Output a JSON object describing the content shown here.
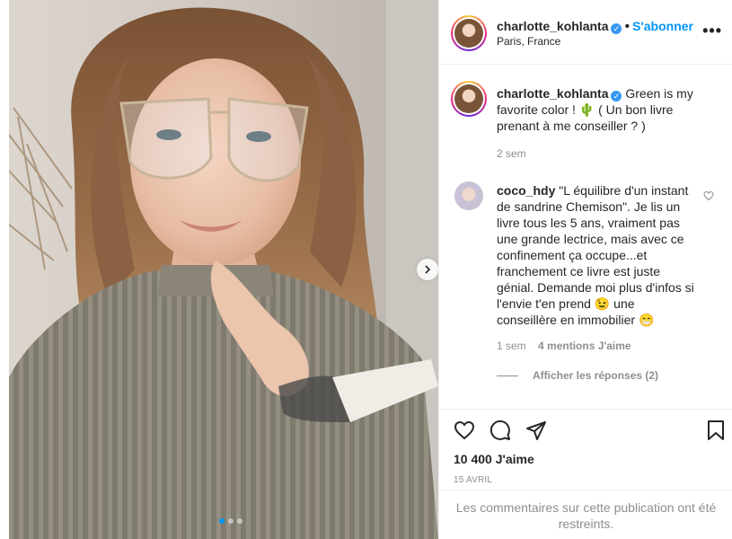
{
  "post": {
    "username": "charlotte_kohlanta",
    "verified": true,
    "follow_label": "S'abonner",
    "location": "Paris, France",
    "more_icon": "more-horizontal-icon"
  },
  "caption": {
    "username": "charlotte_kohlanta",
    "text": "Green is my favorite color ! 🌵 ( Un bon livre prenant à me conseiller ? )",
    "time": "2 sem"
  },
  "comment": {
    "username": "coco_hdy",
    "text": "\"L équilibre d'un instant de sandrine Chemison\". Je lis un livre tous les 5 ans, vraiment pas une grande lectrice, mais avec ce confinement ça occupe...et franchement ce livre est juste génial. Demande moi plus d'infos si l'envie t'en prend 😉 une conseillère en immobilier 😁",
    "time": "1 sem",
    "likes": "4 mentions J'aime",
    "replies_label": "Afficher les réponses (2)"
  },
  "actions": {
    "like_count": "10 400 J'aime",
    "date": "15 AVRIL"
  },
  "restricted_text": "Les commentaires sur cette publication ont été restreints.",
  "carousel": {
    "slide_count": 3,
    "active_index": 0
  },
  "colors": {
    "accent_blue": "#0095f6",
    "verified_blue": "#3897f0",
    "muted_text": "#8e8e8e",
    "border": "#efefef"
  }
}
